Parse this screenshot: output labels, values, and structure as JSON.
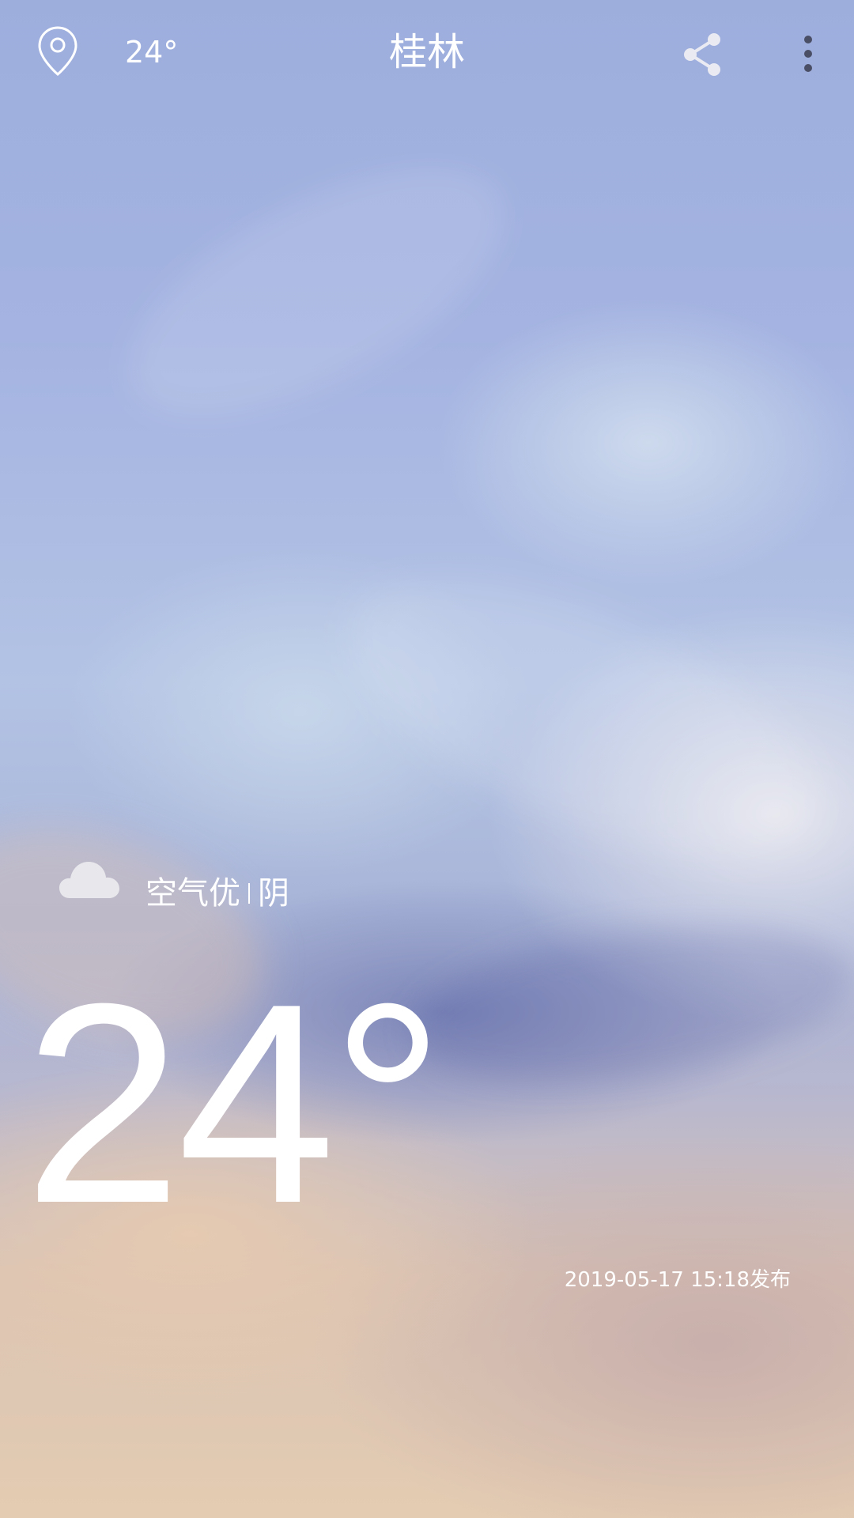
{
  "topbar": {
    "location_icon": "location-pin-icon",
    "temperature": "24°",
    "city": "桂林",
    "share_icon": "share-icon",
    "more_icon": "more-vertical-icon"
  },
  "weather": {
    "condition_icon": "cloud-icon",
    "air_quality": "空气优",
    "condition": "阴",
    "temperature": "24°",
    "published": "2019-05-17 15:18发布"
  }
}
